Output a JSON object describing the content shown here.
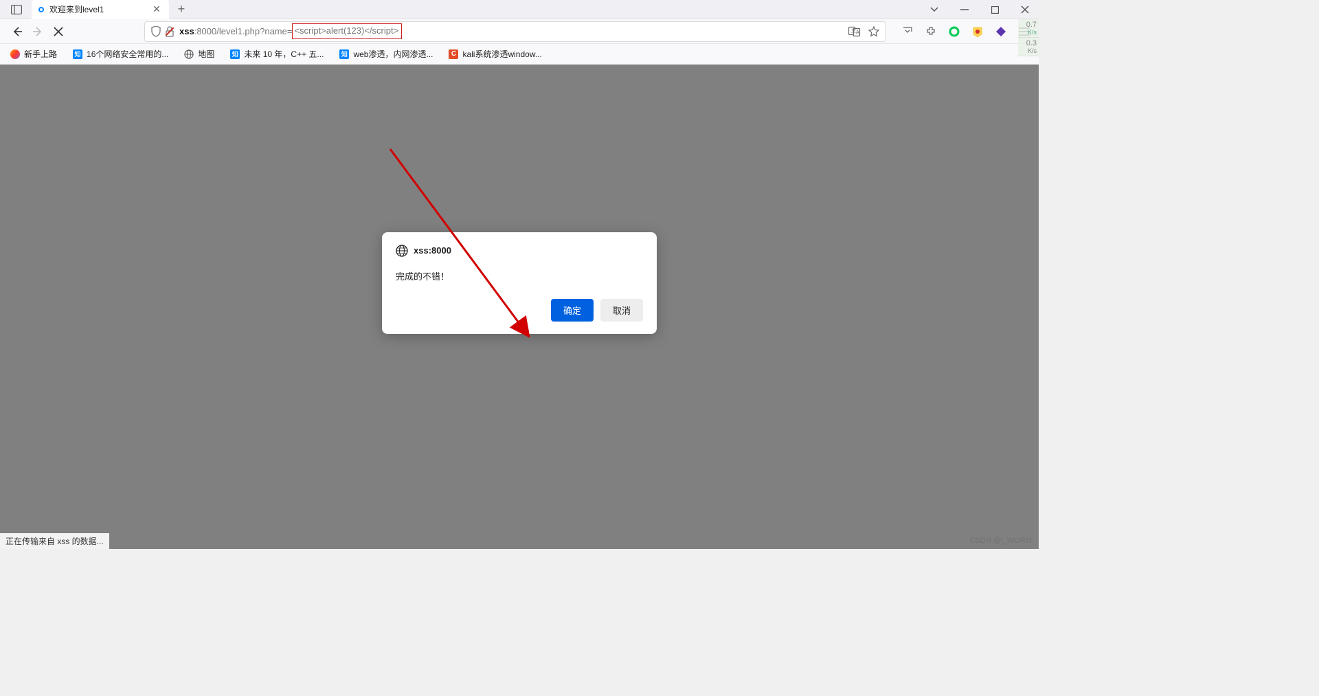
{
  "tab": {
    "title": "欢迎来到level1"
  },
  "url": {
    "host_bold": "xss",
    "host_rest": ":8000/level1.php?name=",
    "query_highlighted": "<script>alert(123)</script>"
  },
  "bookmarks": [
    {
      "label": "新手上路",
      "icon": "firefox"
    },
    {
      "label": "16个网络安全常用的...",
      "icon": "zhihu"
    },
    {
      "label": "地图",
      "icon": "globe"
    },
    {
      "label": "未来 10 年，C++ 五...",
      "icon": "zhihu"
    },
    {
      "label": "web渗透，内网渗透...",
      "icon": "zhihu"
    },
    {
      "label": "kali系统渗透window...",
      "icon": "kali"
    }
  ],
  "dialog": {
    "origin": "xss:8000",
    "message": "完成的不错！",
    "ok": "确定",
    "cancel": "取消"
  },
  "status_bar": "正在传输来自 xss 的数据...",
  "speed": {
    "up_val": "0.7",
    "up_unit": "K/s",
    "down_val": "0.3",
    "down_unit": "K/s"
  },
  "watermark": "CSDN @I_WORM"
}
